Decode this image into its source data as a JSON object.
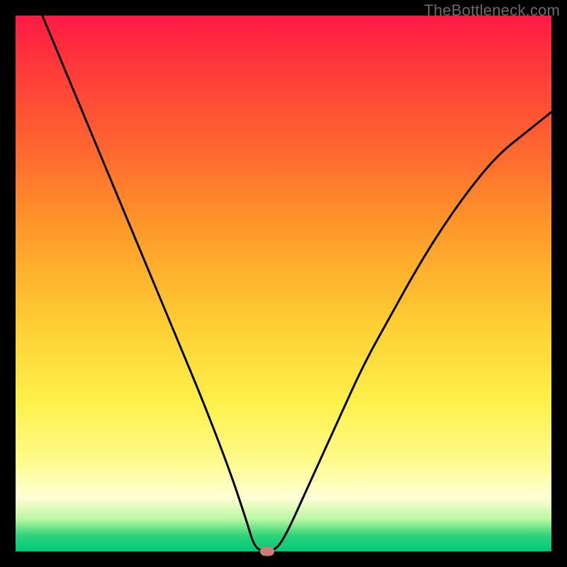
{
  "watermark": "TheBottleneck.com",
  "colors": {
    "frame": "#000000",
    "curve": "#000000",
    "marker": "#cf7b77",
    "gradient_stops": [
      "#ff1a44",
      "#ff3a3a",
      "#ff6a2f",
      "#ff9a2a",
      "#ffcf33",
      "#fff04a",
      "#fffb8a",
      "#ffffd6",
      "#b8f7a0",
      "#2fd47a",
      "#00c878"
    ]
  },
  "chart_data": {
    "type": "line",
    "title": "",
    "xlabel": "",
    "ylabel": "",
    "xlim": [
      0,
      100
    ],
    "ylim": [
      0,
      100
    ],
    "grid": false,
    "curve_points": [
      {
        "x": 5,
        "y": 100
      },
      {
        "x": 10,
        "y": 88
      },
      {
        "x": 15,
        "y": 76
      },
      {
        "x": 20,
        "y": 64
      },
      {
        "x": 25,
        "y": 52
      },
      {
        "x": 30,
        "y": 40
      },
      {
        "x": 35,
        "y": 28
      },
      {
        "x": 40,
        "y": 15
      },
      {
        "x": 43,
        "y": 6
      },
      {
        "x": 44.5,
        "y": 1
      },
      {
        "x": 46,
        "y": 0
      },
      {
        "x": 48,
        "y": 0
      },
      {
        "x": 50,
        "y": 2
      },
      {
        "x": 55,
        "y": 13
      },
      {
        "x": 60,
        "y": 24
      },
      {
        "x": 65,
        "y": 35
      },
      {
        "x": 70,
        "y": 44
      },
      {
        "x": 75,
        "y": 53
      },
      {
        "x": 80,
        "y": 61
      },
      {
        "x": 85,
        "y": 68
      },
      {
        "x": 90,
        "y": 74
      },
      {
        "x": 95,
        "y": 78
      },
      {
        "x": 100,
        "y": 82
      }
    ],
    "marker": {
      "x": 47,
      "y": 0
    }
  }
}
